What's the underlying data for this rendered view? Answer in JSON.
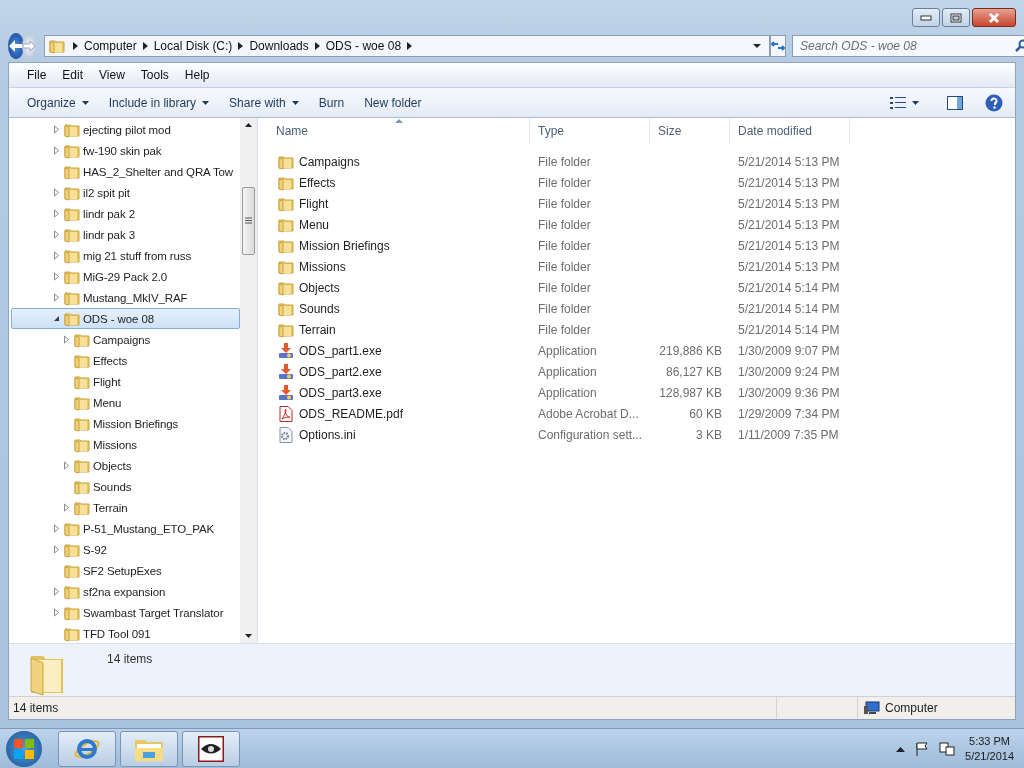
{
  "address_bar": {
    "breadcrumbs": [
      "Computer",
      "Local Disk (C:)",
      "Downloads",
      "ODS - woe 08"
    ]
  },
  "search": {
    "placeholder": "Search ODS - woe 08"
  },
  "menu_bar": [
    "File",
    "Edit",
    "View",
    "Tools",
    "Help"
  ],
  "toolbar": [
    {
      "label": "Organize",
      "dropdown": true
    },
    {
      "label": "Include in library",
      "dropdown": true
    },
    {
      "label": "Share with",
      "dropdown": true
    },
    {
      "label": "Burn",
      "dropdown": false
    },
    {
      "label": "New folder",
      "dropdown": false
    }
  ],
  "navigation_tree": {
    "items": [
      {
        "label": "ejecting pilot mod",
        "expandable": true,
        "expanded": false,
        "selected": false
      },
      {
        "label": "fw-190 skin pak",
        "expandable": true,
        "expanded": false,
        "selected": false
      },
      {
        "label": "HAS_2_Shelter and QRA Tow",
        "expandable": false,
        "expanded": false,
        "selected": false
      },
      {
        "label": "il2 spit pit",
        "expandable": true,
        "expanded": false,
        "selected": false
      },
      {
        "label": "lindr pak 2",
        "expandable": true,
        "expanded": false,
        "selected": false
      },
      {
        "label": "lindr pak 3",
        "expandable": true,
        "expanded": false,
        "selected": false
      },
      {
        "label": "mig 21 stuff from russ",
        "expandable": true,
        "expanded": false,
        "selected": false
      },
      {
        "label": "MiG-29 Pack 2.0",
        "expandable": true,
        "expanded": false,
        "selected": false
      },
      {
        "label": "Mustang_MkIV_RAF",
        "expandable": true,
        "expanded": false,
        "selected": false
      },
      {
        "label": "ODS - woe 08",
        "expandable": true,
        "expanded": true,
        "selected": true,
        "children": [
          {
            "label": "Campaigns",
            "expandable": true,
            "expanded": false,
            "selected": false
          },
          {
            "label": "Effects",
            "expandable": false,
            "expanded": false,
            "selected": false
          },
          {
            "label": "Flight",
            "expandable": false,
            "expanded": false,
            "selected": false
          },
          {
            "label": "Menu",
            "expandable": false,
            "expanded": false,
            "selected": false
          },
          {
            "label": "Mission Briefings",
            "expandable": false,
            "expanded": false,
            "selected": false
          },
          {
            "label": "Missions",
            "expandable": false,
            "expanded": false,
            "selected": false
          },
          {
            "label": "Objects",
            "expandable": true,
            "expanded": false,
            "selected": false
          },
          {
            "label": "Sounds",
            "expandable": false,
            "expanded": false,
            "selected": false
          },
          {
            "label": "Terrain",
            "expandable": true,
            "expanded": false,
            "selected": false
          }
        ]
      },
      {
        "label": "P-51_Mustang_ETO_PAK",
        "expandable": true,
        "expanded": false,
        "selected": false
      },
      {
        "label": "S-92",
        "expandable": true,
        "expanded": false,
        "selected": false
      },
      {
        "label": "SF2 SetupExes",
        "expandable": false,
        "expanded": false,
        "selected": false
      },
      {
        "label": "sf2na expansion",
        "expandable": true,
        "expanded": false,
        "selected": false
      },
      {
        "label": "Swambast Target Translator",
        "expandable": true,
        "expanded": false,
        "selected": false
      },
      {
        "label": "TFD Tool 091",
        "expandable": false,
        "expanded": false,
        "selected": false
      }
    ]
  },
  "file_list": {
    "columns": [
      "Name",
      "Type",
      "Size",
      "Date modified"
    ],
    "rows": [
      {
        "kind": "folder",
        "name": "Campaigns",
        "type": "File folder",
        "size": "",
        "date": "5/21/2014 5:13 PM"
      },
      {
        "kind": "folder",
        "name": "Effects",
        "type": "File folder",
        "size": "",
        "date": "5/21/2014 5:13 PM"
      },
      {
        "kind": "folder",
        "name": "Flight",
        "type": "File folder",
        "size": "",
        "date": "5/21/2014 5:13 PM"
      },
      {
        "kind": "folder",
        "name": "Menu",
        "type": "File folder",
        "size": "",
        "date": "5/21/2014 5:13 PM"
      },
      {
        "kind": "folder",
        "name": "Mission Briefings",
        "type": "File folder",
        "size": "",
        "date": "5/21/2014 5:13 PM"
      },
      {
        "kind": "folder",
        "name": "Missions",
        "type": "File folder",
        "size": "",
        "date": "5/21/2014 5:13 PM"
      },
      {
        "kind": "folder",
        "name": "Objects",
        "type": "File folder",
        "size": "",
        "date": "5/21/2014 5:14 PM"
      },
      {
        "kind": "folder",
        "name": "Sounds",
        "type": "File folder",
        "size": "",
        "date": "5/21/2014 5:14 PM"
      },
      {
        "kind": "folder",
        "name": "Terrain",
        "type": "File folder",
        "size": "",
        "date": "5/21/2014 5:14 PM"
      },
      {
        "kind": "installer",
        "name": "ODS_part1.exe",
        "type": "Application",
        "size": "219,886 KB",
        "date": "1/30/2009 9:07 PM"
      },
      {
        "kind": "installer",
        "name": "ODS_part2.exe",
        "type": "Application",
        "size": "86,127 KB",
        "date": "1/30/2009 9:24 PM"
      },
      {
        "kind": "installer",
        "name": "ODS_part3.exe",
        "type": "Application",
        "size": "128,987 KB",
        "date": "1/30/2009 9:36 PM"
      },
      {
        "kind": "pdf",
        "name": "ODS_README.pdf",
        "type": "Adobe Acrobat D...",
        "size": "60 KB",
        "date": "1/29/2009 7:34 PM"
      },
      {
        "kind": "settings",
        "name": "Options.ini",
        "type": "Configuration sett...",
        "size": "3 KB",
        "date": "1/11/2009 7:35 PM"
      }
    ]
  },
  "details_pane": {
    "item_count": "14 items"
  },
  "status_bar": {
    "item_count": "14 items",
    "location": "Computer"
  },
  "taskbar": {
    "time": "5:33 PM",
    "date": "5/21/2014"
  }
}
